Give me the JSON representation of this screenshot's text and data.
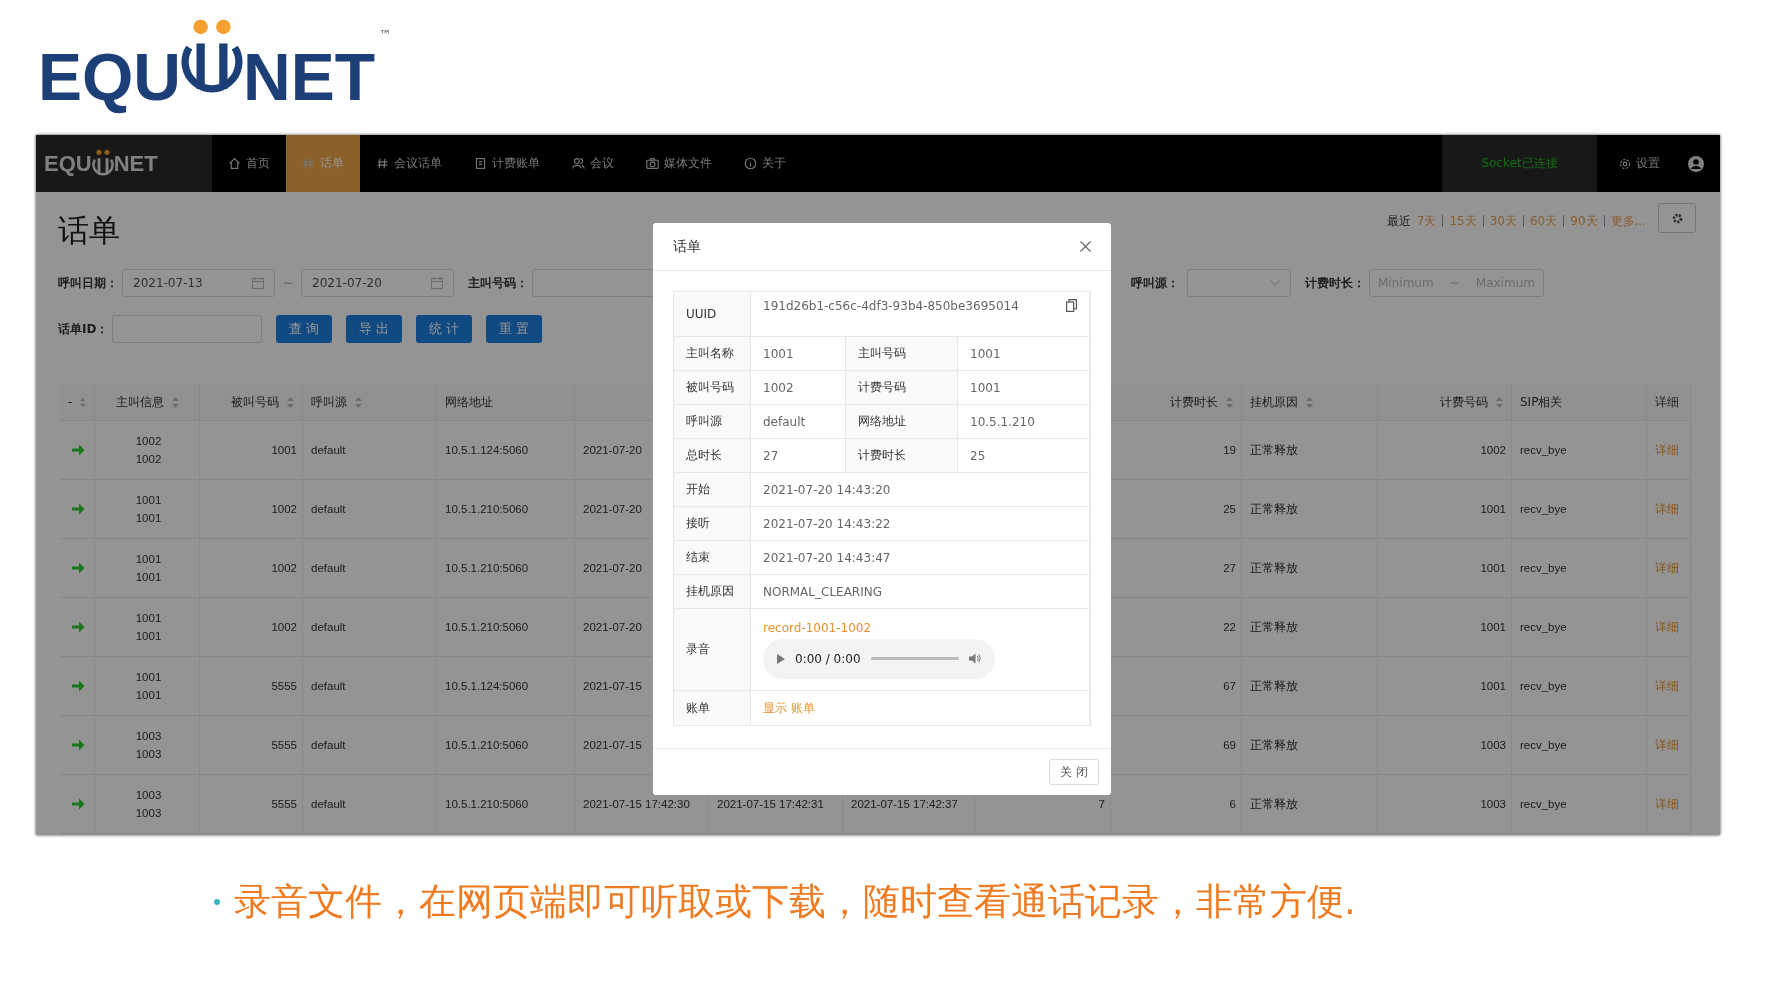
{
  "slide_logo": {
    "left": "EQU",
    "right": "NET",
    "trademark": "™"
  },
  "app": {
    "logo": {
      "left": "EQU",
      "right": "NET"
    },
    "nav": [
      {
        "label": "首页",
        "kind": "home",
        "selected": false
      },
      {
        "label": "话单",
        "kind": "hash",
        "selected": true
      },
      {
        "label": "会议话单",
        "kind": "hash",
        "selected": false
      },
      {
        "label": "计费账单",
        "kind": "bill",
        "selected": false
      },
      {
        "label": "会议",
        "kind": "people",
        "selected": false
      },
      {
        "label": "媒体文件",
        "kind": "camera",
        "selected": false
      },
      {
        "label": "关于",
        "kind": "info",
        "selected": false
      }
    ],
    "socket_status": "Socket已连接",
    "settings": "设置"
  },
  "page_title": "话单",
  "quick_ranges": {
    "prefix": "最近",
    "items": [
      "7天",
      "15天",
      "30天",
      "60天",
      "90天",
      "更多..."
    ]
  },
  "filters": {
    "date_label": "呼叫日期：",
    "date_from": "2021-07-13",
    "date_sep": "~",
    "date_to": "2021-07-20",
    "caller_label": "主叫号码：",
    "source_label": "呼叫源：",
    "billsec_label": "计费时长：",
    "billsec_min_placeholder": "Minimum",
    "billsec_sep": "~",
    "billsec_max_placeholder": "Maximum",
    "id_label": "话单ID：",
    "buttons": [
      "查 询",
      "导 出",
      "统 计",
      "重 置"
    ]
  },
  "table": {
    "columns": [
      {
        "label": "-",
        "sortable": true
      },
      {
        "label": "主叫信息",
        "sortable": true
      },
      {
        "label": "被叫号码",
        "sortable": true
      },
      {
        "label": "呼叫源",
        "sortable": true
      },
      {
        "label": "网络地址",
        "sortable": false
      },
      {
        "label": "计费时长",
        "sortable": true
      },
      {
        "label": "挂机原因",
        "sortable": true
      },
      {
        "label": "计费号码",
        "sortable": true
      },
      {
        "label": "SIP相关",
        "sortable": false
      },
      {
        "label": "详细",
        "sortable": false
      }
    ],
    "rows": [
      {
        "caller_name": "1002",
        "caller_number": "1002",
        "callee": "1001",
        "source": "default",
        "address": "10.5.1.124:5060",
        "start": "2021-07-20",
        "billsec": "19",
        "hangup_cause": "正常释放",
        "billing_number": "1002",
        "sip": "recv_bye",
        "detail": "详细"
      },
      {
        "caller_name": "1001",
        "caller_number": "1001",
        "callee": "1002",
        "source": "default",
        "address": "10.5.1.210:5060",
        "start": "2021-07-20",
        "billsec": "25",
        "hangup_cause": "正常释放",
        "billing_number": "1001",
        "sip": "recv_bye",
        "detail": "详细"
      },
      {
        "caller_name": "1001",
        "caller_number": "1001",
        "callee": "1002",
        "source": "default",
        "address": "10.5.1.210:5060",
        "start": "2021-07-20",
        "billsec": "27",
        "hangup_cause": "正常释放",
        "billing_number": "1001",
        "sip": "recv_bye",
        "detail": "详细"
      },
      {
        "caller_name": "1001",
        "caller_number": "1001",
        "callee": "1002",
        "source": "default",
        "address": "10.5.1.210:5060",
        "start": "2021-07-20",
        "billsec": "22",
        "hangup_cause": "正常释放",
        "billing_number": "1001",
        "sip": "recv_bye",
        "detail": "详细"
      },
      {
        "caller_name": "1001",
        "caller_number": "1001",
        "callee": "5555",
        "source": "default",
        "address": "10.5.1.124:5060",
        "start": "2021-07-15",
        "billsec": "67",
        "hangup_cause": "正常释放",
        "billing_number": "1001",
        "sip": "recv_bye",
        "detail": "详细"
      },
      {
        "caller_name": "1003",
        "caller_number": "1003",
        "callee": "5555",
        "source": "default",
        "address": "10.5.1.210:5060",
        "start": "2021-07-15",
        "billsec": "69",
        "hangup_cause": "正常释放",
        "billing_number": "1003",
        "sip": "recv_bye",
        "detail": "详细"
      },
      {
        "caller_name": "1003",
        "caller_number": "1003",
        "callee": "5555",
        "source": "default",
        "address": "10.5.1.210:5060",
        "start": "2021-07-15 17:42:30",
        "answer": "2021-07-15 17:42:31",
        "end": "2021-07-15 17:42:37",
        "duration": "7",
        "billsec": "6",
        "hangup_cause": "正常释放",
        "billing_number": "1003",
        "sip": "recv_bye",
        "detail": "详细"
      }
    ]
  },
  "modal": {
    "title": "话单",
    "uuid": {
      "label": "UUID",
      "value": "191d26b1-c56c-4df3-93b4-850be3695014"
    },
    "pairs": [
      [
        {
          "label": "主叫名称",
          "value": "1001"
        },
        {
          "label": "主叫号码",
          "value": "1001"
        }
      ],
      [
        {
          "label": "被叫号码",
          "value": "1002"
        },
        {
          "label": "计费号码",
          "value": "1001"
        }
      ],
      [
        {
          "label": "呼叫源",
          "value": "default"
        },
        {
          "label": "网络地址",
          "value": "10.5.1.210"
        }
      ],
      [
        {
          "label": "总时长",
          "value": "27"
        },
        {
          "label": "计费时长",
          "value": "25"
        }
      ]
    ],
    "rows": [
      {
        "label": "开始",
        "value": "2021-07-20 14:43:20"
      },
      {
        "label": "接听",
        "value": "2021-07-20 14:43:22"
      },
      {
        "label": "结束",
        "value": "2021-07-20 14:43:47"
      },
      {
        "label": "挂机原因",
        "value": "NORMAL_CLEARING"
      }
    ],
    "recording": {
      "label": "录音",
      "file": "record-1001-1002",
      "time": "0:00 / 0:00"
    },
    "bill": {
      "label": "账单",
      "link": "显示 账单"
    },
    "close_button": "关 闭"
  },
  "caption": "录音文件，在网页端即可听取或下载，随时查看通话记录，非常方便."
}
